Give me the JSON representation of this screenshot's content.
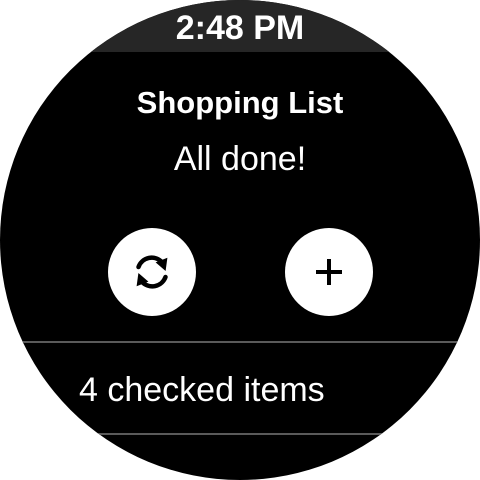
{
  "status_bar": {
    "time": "2:48 PM"
  },
  "screen": {
    "title": "Shopping List",
    "subtitle": "All done!"
  },
  "actions": {
    "refresh_icon": "refresh-icon",
    "add_icon": "plus-icon"
  },
  "list": {
    "checked_items_label": "4 checked items"
  },
  "colors": {
    "background": "#000000",
    "status_bar": "#262626",
    "text": "#ffffff",
    "button": "#ffffff",
    "icon": "#000000",
    "divider": "#5a5a5a"
  }
}
